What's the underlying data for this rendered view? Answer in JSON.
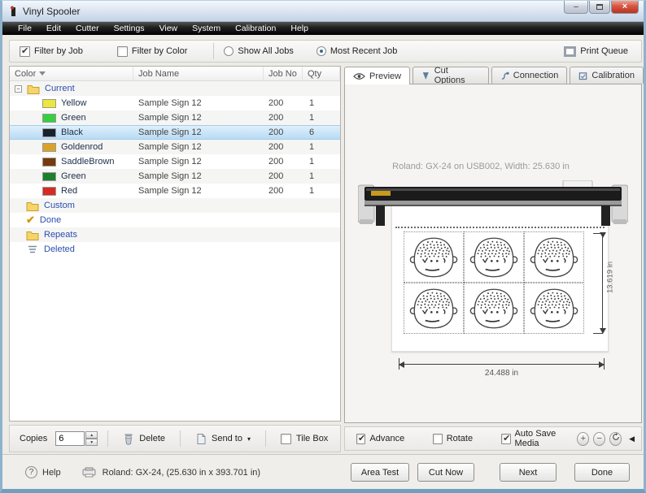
{
  "window": {
    "title": "Vinyl Spooler"
  },
  "menu": {
    "items": [
      "File",
      "Edit",
      "Cutter",
      "Settings",
      "View",
      "System",
      "Calibration",
      "Help"
    ]
  },
  "filter_bar": {
    "filter_by_job": {
      "label": "Filter by Job",
      "checked": true
    },
    "filter_by_color": {
      "label": "Filter by Color",
      "checked": false
    },
    "show_all_jobs": {
      "label": "Show All Jobs",
      "selected": false
    },
    "most_recent_job": {
      "label": "Most Recent Job",
      "selected": true
    },
    "print_queue_label": "Print Queue"
  },
  "job_list": {
    "columns": {
      "color": "Color",
      "job_name": "Job Name",
      "job_no": "Job No",
      "qty": "Qty"
    },
    "folders": {
      "current": "Current",
      "custom": "Custom",
      "done": "Done",
      "repeats": "Repeats",
      "deleted": "Deleted"
    },
    "rows": [
      {
        "color_name": "Yellow",
        "swatch": "#ede73a",
        "job_name": "Sample Sign 12",
        "job_no": "200",
        "qty": "1",
        "selected": false
      },
      {
        "color_name": "Green",
        "swatch": "#35cf3f",
        "job_name": "Sample Sign 12",
        "job_no": "200",
        "qty": "1",
        "selected": false
      },
      {
        "color_name": "Black",
        "swatch": "#18222c",
        "job_name": "Sample Sign 12",
        "job_no": "200",
        "qty": "6",
        "selected": true
      },
      {
        "color_name": "Goldenrod",
        "swatch": "#d9a22b",
        "job_name": "Sample Sign 12",
        "job_no": "200",
        "qty": "1",
        "selected": false
      },
      {
        "color_name": "SaddleBrown",
        "swatch": "#78390f",
        "job_name": "Sample Sign 12",
        "job_no": "200",
        "qty": "1",
        "selected": false
      },
      {
        "color_name": "Green",
        "swatch": "#1e7f2c",
        "job_name": "Sample Sign 12",
        "job_no": "200",
        "qty": "1",
        "selected": false
      },
      {
        "color_name": "Red",
        "swatch": "#d52b24",
        "job_name": "Sample Sign 12",
        "job_no": "200",
        "qty": "1",
        "selected": false
      }
    ]
  },
  "copies_bar": {
    "copies_label": "Copies",
    "copies_value": "6",
    "delete_label": "Delete",
    "send_to_label": "Send to",
    "tile_box": {
      "label": "Tile Box",
      "checked": false
    }
  },
  "preview_panel": {
    "tabs": [
      {
        "label": "Preview",
        "active": true
      },
      {
        "label": "Cut Options",
        "active": false
      },
      {
        "label": "Connection",
        "active": false
      },
      {
        "label": "Calibration",
        "active": false
      }
    ],
    "status_line": "Roland: GX-24 on USB002,   Width: 25.630 in",
    "sheet": {
      "faces_rows": 2,
      "faces_cols": 3,
      "height_label": "13.619 in",
      "width_label": "24.488 in"
    },
    "options": {
      "advance": {
        "label": "Advance",
        "checked": true
      },
      "rotate": {
        "label": "Rotate",
        "checked": false
      },
      "auto_save_media": {
        "label": "Auto Save Media",
        "checked": true
      }
    }
  },
  "status_bar": {
    "help_label": "Help",
    "device_info": "Roland: GX-24,  (25.630 in x 393.701 in)"
  },
  "actions": [
    {
      "label": "Area Test"
    },
    {
      "label": "Cut Now"
    },
    {
      "label": "Next"
    },
    {
      "label": "Done"
    }
  ]
}
